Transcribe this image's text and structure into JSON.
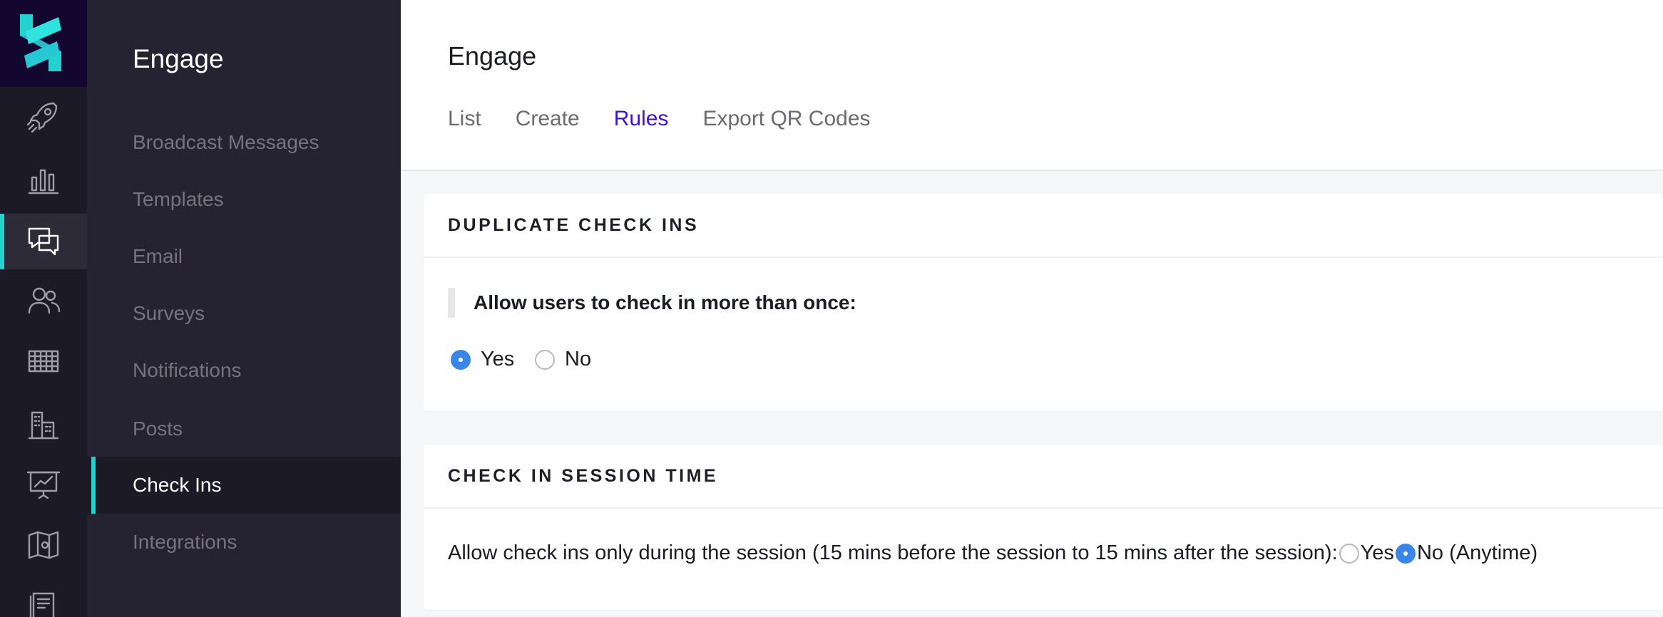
{
  "rail": {
    "icons": [
      {
        "name": "rocket-icon"
      },
      {
        "name": "bar-chart-icon"
      },
      {
        "name": "chat-bubbles-icon"
      },
      {
        "name": "users-icon"
      },
      {
        "name": "grid-table-icon"
      },
      {
        "name": "buildings-icon"
      },
      {
        "name": "presentation-icon"
      },
      {
        "name": "map-icon"
      },
      {
        "name": "document-icon"
      }
    ],
    "active_icon": "chat-bubbles-icon",
    "accent_color": "#23d2cf"
  },
  "subnav": {
    "title": "Engage",
    "items": [
      {
        "label": "Broadcast Messages"
      },
      {
        "label": "Templates"
      },
      {
        "label": "Email"
      },
      {
        "label": "Surveys"
      },
      {
        "label": "Notifications"
      },
      {
        "label": "Posts"
      },
      {
        "label": "Check Ins",
        "active": true
      },
      {
        "label": "Integrations"
      }
    ]
  },
  "header": {
    "title": "Engage",
    "tabs": [
      {
        "label": "List"
      },
      {
        "label": "Create"
      },
      {
        "label": "Rules",
        "active": true
      },
      {
        "label": "Export QR Codes"
      }
    ],
    "active_tab_color": "#3b12e0"
  },
  "duplicate_card": {
    "title": "DUPLICATE CHECK INS",
    "question": "Allow users to check in more than once:",
    "options": [
      {
        "label": "Yes",
        "checked": true
      },
      {
        "label": "No",
        "checked": false
      }
    ]
  },
  "session_card": {
    "title": "CHECK IN SESSION TIME",
    "question": "Allow check ins only during the session (15 mins before the session to 15 mins after the session):",
    "options": [
      {
        "label": "Yes",
        "checked": false
      },
      {
        "label": "No (Anytime)",
        "checked": true
      }
    ]
  },
  "radio_color": "#3a86e8"
}
